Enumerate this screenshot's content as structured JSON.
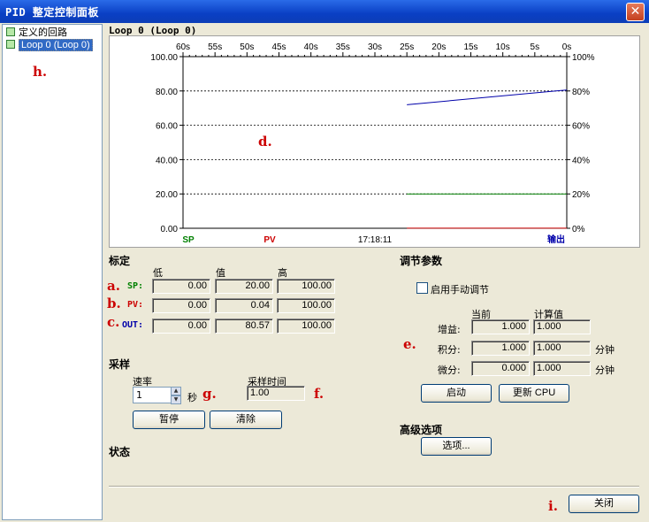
{
  "window": {
    "title": "PID 整定控制面板",
    "close_glyph": "✕"
  },
  "tree": {
    "items": [
      {
        "label": "定义的回路",
        "icon": "loop-folder-icon"
      },
      {
        "label": "Loop 0 (Loop 0)",
        "icon": "loop-icon",
        "selected": true
      }
    ]
  },
  "annotations": {
    "a": "a.",
    "b": "b.",
    "c": "c.",
    "d": "d.",
    "e": "e.",
    "f": "f.",
    "g": "g.",
    "h": "h.",
    "i": "i."
  },
  "chart_data": {
    "type": "line",
    "title": "Loop 0 (Loop 0)",
    "x_ticks": [
      "60s",
      "55s",
      "50s",
      "45s",
      "40s",
      "35s",
      "30s",
      "25s",
      "20s",
      "15s",
      "10s",
      "5s",
      "0s"
    ],
    "y_left_ticks": [
      "100.00",
      "80.00",
      "60.00",
      "40.00",
      "20.00",
      "0.00"
    ],
    "y_right_ticks": [
      "100%",
      "80%",
      "60%",
      "40%",
      "20%",
      "0%"
    ],
    "ylim": [
      0,
      100
    ],
    "xlim_seconds_ago": [
      60,
      0
    ],
    "grid": true,
    "time_label": "17:18:11",
    "series": [
      {
        "name": "SP",
        "color": "#008000",
        "x": [
          25,
          0
        ],
        "y": [
          20,
          20
        ]
      },
      {
        "name": "PV",
        "color": "#cc0000",
        "x": [
          25,
          0
        ],
        "y": [
          0.04,
          0.04
        ]
      },
      {
        "name": "输出",
        "color": "#0000aa",
        "x": [
          25,
          0
        ],
        "y": [
          72,
          80.57
        ]
      }
    ]
  },
  "calibration": {
    "title": "标定",
    "col_low": "低",
    "col_value": "值",
    "col_high": "高",
    "rows": [
      {
        "label": "SP:",
        "color": "#008000",
        "low": "0.00",
        "value": "20.00",
        "high": "100.00"
      },
      {
        "label": "PV:",
        "color": "#cc0000",
        "low": "0.00",
        "value": "0.04",
        "high": "100.00"
      },
      {
        "label": "OUT:",
        "color": "#0000aa",
        "low": "0.00",
        "value": "80.57",
        "high": "100.00"
      }
    ]
  },
  "sampling": {
    "title": "采样",
    "rate_label": "速率",
    "rate_value": "1",
    "rate_unit": "秒",
    "sample_time_label": "采样时间",
    "sample_time_value": "1.00",
    "pause_button": "暂停",
    "clear_button": "清除"
  },
  "status": {
    "title": "状态"
  },
  "tuning": {
    "title": "调节参数",
    "manual_checkbox_label": "启用手动调节",
    "col_current": "当前",
    "col_computed": "计算值",
    "rows": [
      {
        "label": "增益:",
        "current": "1.000",
        "computed": "1.000",
        "unit": ""
      },
      {
        "label": "积分:",
        "current": "1.000",
        "computed": "1.000",
        "unit": "分钟"
      },
      {
        "label": "微分:",
        "current": "0.000",
        "computed": "1.000",
        "unit": "分钟"
      }
    ],
    "start_button": "启动",
    "update_cpu_button": "更新 CPU"
  },
  "advanced": {
    "title": "高级选项",
    "options_button": "选项..."
  },
  "footer": {
    "close_button": "关闭"
  }
}
